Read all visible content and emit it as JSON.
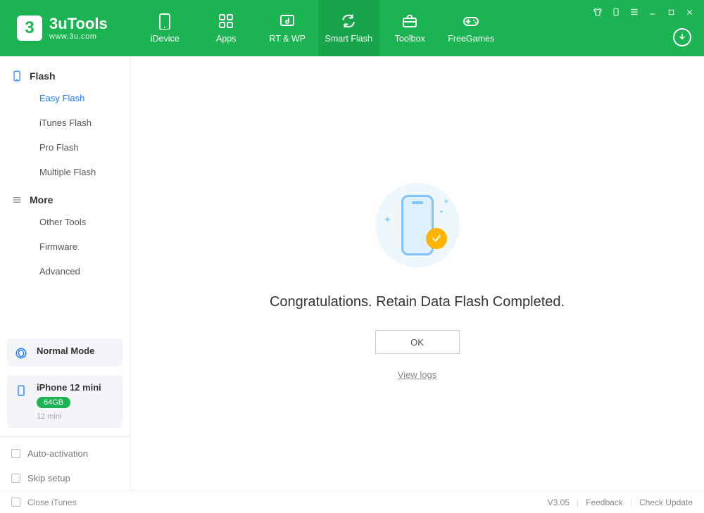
{
  "app": {
    "name": "3uTools",
    "site": "www.3u.com"
  },
  "nav": [
    {
      "label": "iDevice",
      "icon": "phone"
    },
    {
      "label": "Apps",
      "icon": "grid"
    },
    {
      "label": "RT & WP",
      "icon": "music"
    },
    {
      "label": "Smart Flash",
      "icon": "refresh",
      "active": true
    },
    {
      "label": "Toolbox",
      "icon": "toolbox"
    },
    {
      "label": "FreeGames",
      "icon": "gamepad"
    }
  ],
  "sidebar": {
    "flash_header": "Flash",
    "flash_items": [
      {
        "label": "Easy Flash",
        "active": true
      },
      {
        "label": "iTunes Flash"
      },
      {
        "label": "Pro Flash"
      },
      {
        "label": "Multiple Flash"
      }
    ],
    "more_header": "More",
    "more_items": [
      {
        "label": "Other Tools"
      },
      {
        "label": "Firmware"
      },
      {
        "label": "Advanced"
      }
    ],
    "mode_card": {
      "title": "Normal Mode"
    },
    "device_card": {
      "title": "iPhone 12 mini",
      "storage": "64GB",
      "model": "12 mini"
    },
    "checks": [
      {
        "label": "Auto-activation"
      },
      {
        "label": "Skip setup"
      }
    ]
  },
  "main": {
    "message": "Congratulations. Retain Data Flash Completed.",
    "ok": "OK",
    "view_logs": "View logs"
  },
  "footer": {
    "close_itunes": "Close iTunes",
    "version": "V3.05",
    "feedback": "Feedback",
    "check_update": "Check Update"
  }
}
